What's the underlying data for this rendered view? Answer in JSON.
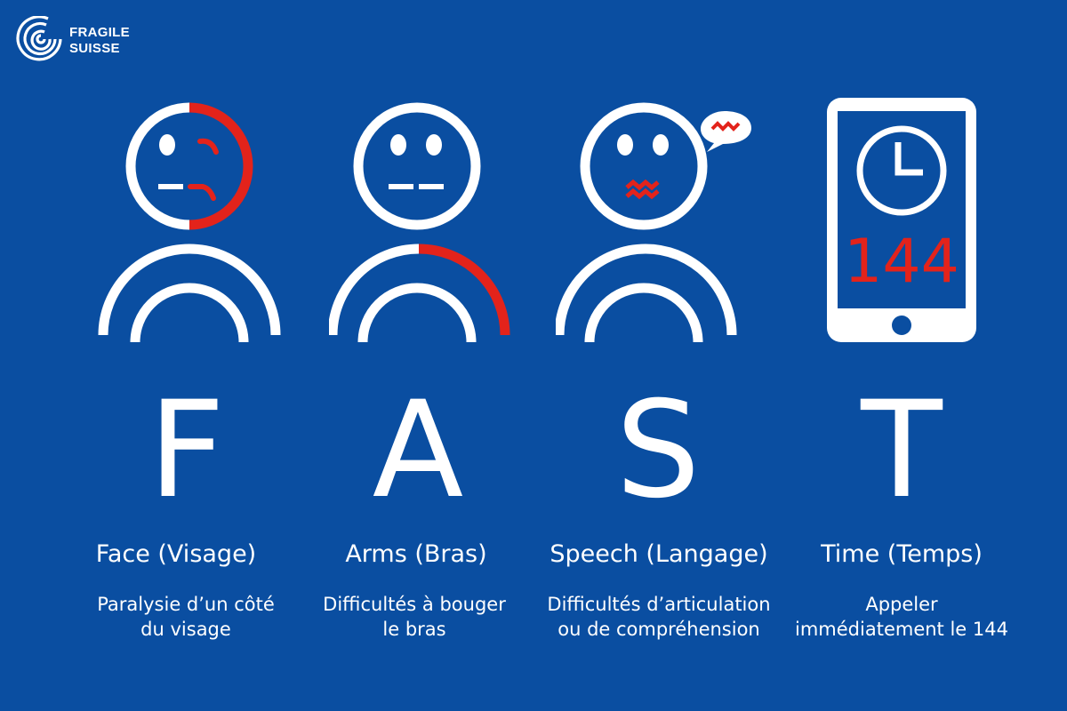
{
  "logo": {
    "line1": "FRAGILE",
    "line2": "SUISSE"
  },
  "colors": {
    "background": "#0a4ea1",
    "accent": "#e3231b",
    "foreground": "#ffffff"
  },
  "phone": {
    "number": "144",
    "icon": "clock-icon"
  },
  "items": [
    {
      "letter": "F",
      "title": "Face (Visage)",
      "desc": [
        "Paralysie d’un côté",
        "du visage"
      ],
      "icon": "drooping-face-icon"
    },
    {
      "letter": "A",
      "title": "Arms (Bras)",
      "desc": [
        "Difficultés à bouger",
        "le bras"
      ],
      "icon": "weak-arm-icon"
    },
    {
      "letter": "S",
      "title": "Speech (Langage)",
      "desc": [
        "Difficultés d’articulation",
        "ou de compréhension"
      ],
      "icon": "slurred-speech-icon"
    },
    {
      "letter": "T",
      "title": "Time (Temps)",
      "desc": [
        "Appeler",
        "immédiatement le 144"
      ],
      "icon": "phone-icon"
    }
  ]
}
